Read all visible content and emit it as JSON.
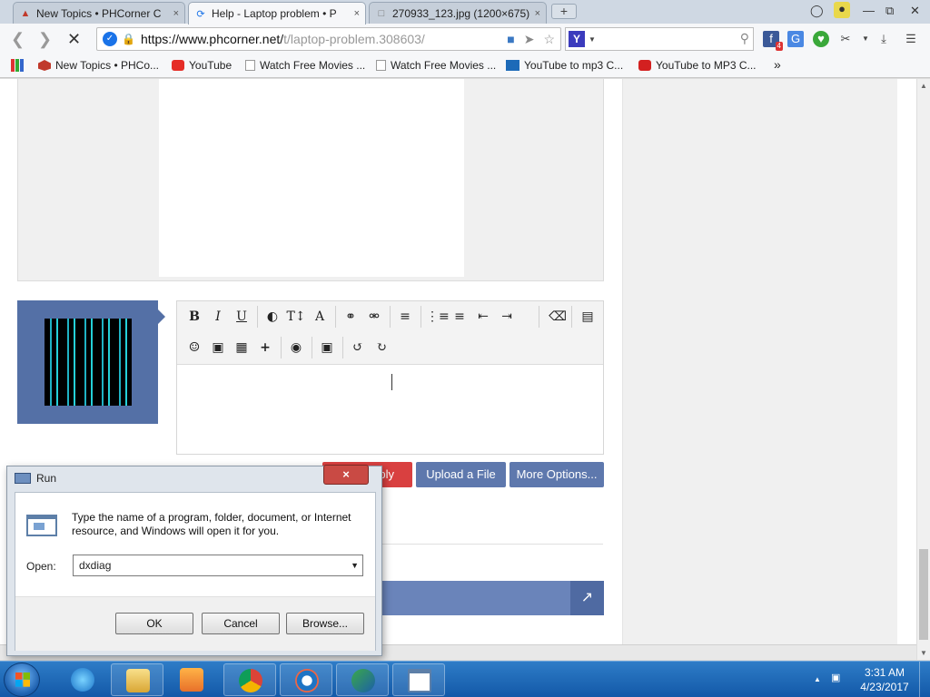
{
  "browser": {
    "tabs": [
      {
        "title": "New Topics • PHCorner C",
        "close": "×"
      },
      {
        "title": "Help - Laptop problem • P",
        "close": "×"
      },
      {
        "title": "270933_123.jpg (1200×675)",
        "close": "×"
      }
    ],
    "new_tab": "+",
    "url_host": "https://www.phcorner.net/",
    "url_path": "t/laptop-problem.308603/",
    "extension_badge": "4",
    "bookmarks": [
      "New Topics • PHCo...",
      "YouTube",
      "Watch Free Movies ...",
      "Watch Free Movies ...",
      "YouTube to mp3 C...",
      "YouTube to MP3 C..."
    ],
    "bookmarks_overflow": "»"
  },
  "page": {
    "buttons": {
      "reply": "ply",
      "upload": "Upload a File",
      "more": "More Options..."
    }
  },
  "run_dialog": {
    "title": "Run",
    "close": "×",
    "description": "Type the name of a program, folder, document, or Internet resource, and Windows will open it for you.",
    "open_label": "Open:",
    "open_value": "dxdiag",
    "ok": "OK",
    "cancel": "Cancel",
    "browse": "Browse..."
  },
  "taskbar": {
    "time": "3:31 AM",
    "date": "4/23/2017"
  }
}
